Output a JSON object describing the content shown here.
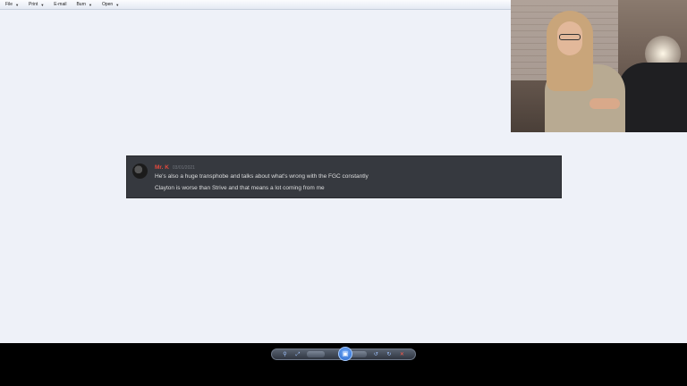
{
  "menubar": {
    "items": [
      {
        "label": "File",
        "has_dropdown": true
      },
      {
        "label": "Print",
        "has_dropdown": true
      },
      {
        "label": "E-mail",
        "has_dropdown": false
      },
      {
        "label": "Burn",
        "has_dropdown": true
      },
      {
        "label": "Open",
        "has_dropdown": true
      }
    ]
  },
  "message": {
    "author": "Mr. K",
    "timestamp": "03/01/2021",
    "lines": [
      "He's also a huge transphobe and talks about what's wrong with the FGC constantly",
      "Clayton is worse than Strive and that means a lot coming from me"
    ]
  },
  "toolbar": {
    "icons": [
      "zoom-icon",
      "fit-window-icon",
      "previous-icon",
      "slideshow-icon",
      "next-icon",
      "rotate-left-icon",
      "rotate-right-icon",
      "delete-icon"
    ],
    "close_glyph": "✕"
  },
  "colors": {
    "author": "#e2483d",
    "message_bg": "#36393f",
    "canvas_bg": "#eef1f8",
    "accent": "#1e5fc4"
  }
}
